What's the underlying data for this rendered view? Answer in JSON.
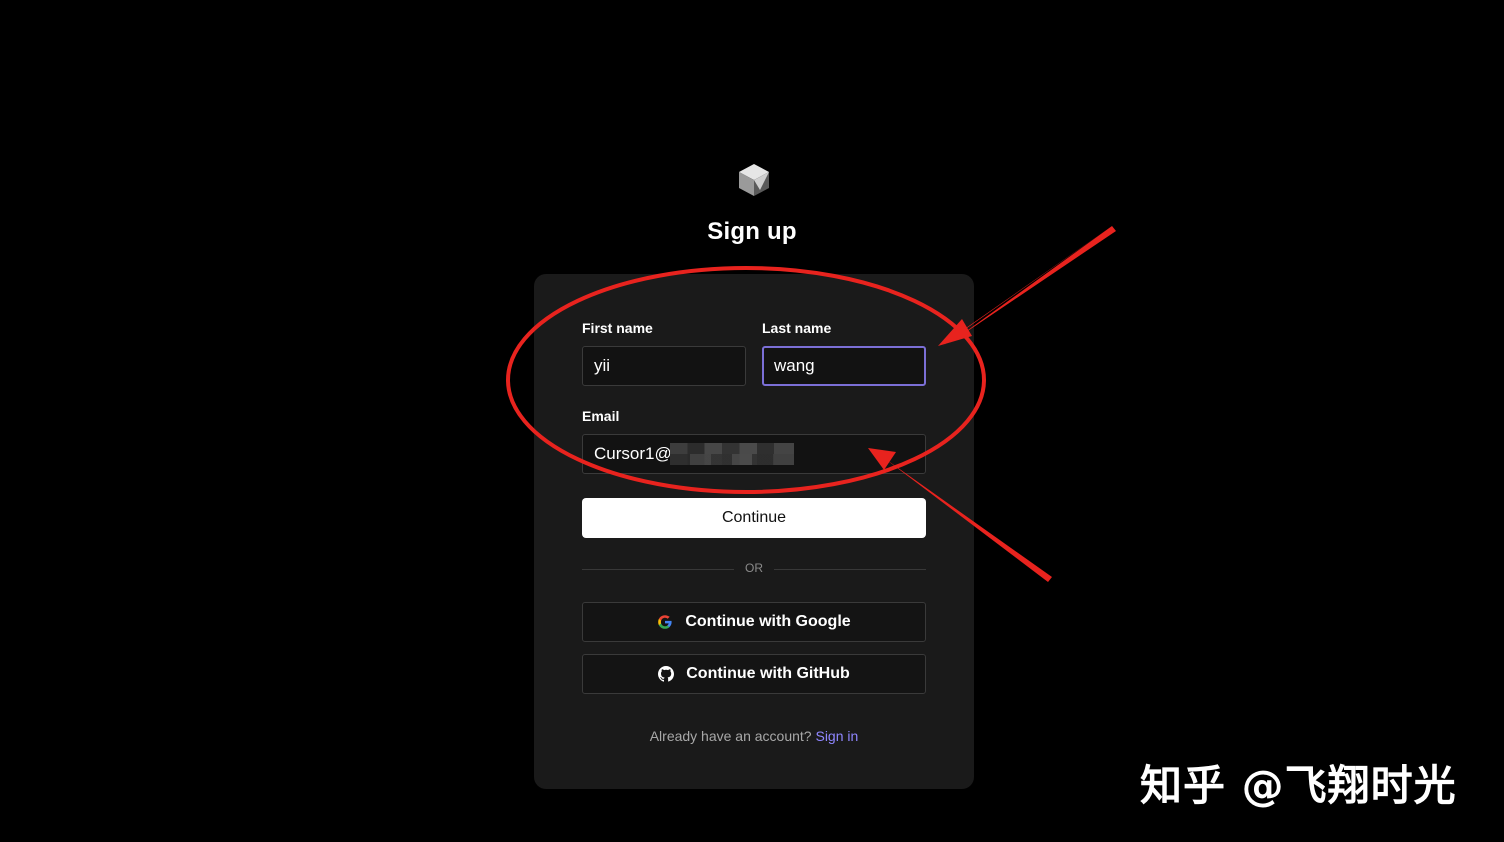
{
  "page": {
    "title": "Sign up"
  },
  "form": {
    "first_name_label": "First name",
    "first_name_value": "yii",
    "last_name_label": "Last name",
    "last_name_value": "wang",
    "email_label": "Email",
    "email_value": "Cursor1@",
    "continue_label": "Continue",
    "divider_label": "OR",
    "google_label": "Continue with Google",
    "github_label": "Continue with GitHub",
    "footer_text": "Already have an account?",
    "sign_in_label": "Sign in"
  },
  "watermark": "知乎 @飞翔时光",
  "colors": {
    "background": "#000000",
    "card": "#1a1a1a",
    "focus_border": "#7b6fd6",
    "link": "#8f86ff",
    "annotation": "#e8231e"
  },
  "icons": [
    "cursor-cube-logo-icon",
    "google-g-icon",
    "github-icon"
  ]
}
